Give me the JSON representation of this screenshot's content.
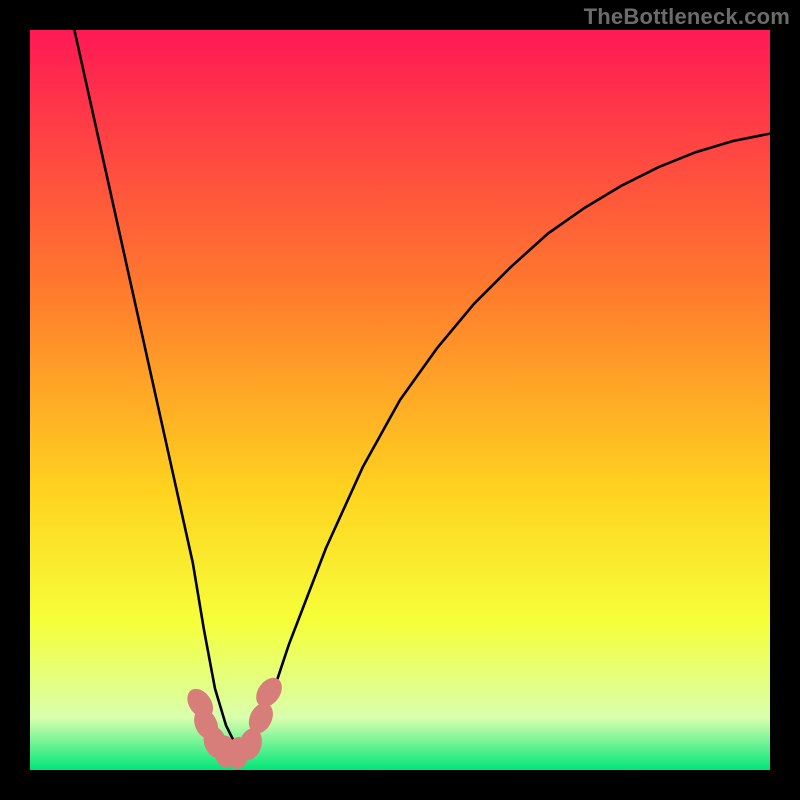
{
  "watermark": "TheBottleneck.com",
  "colors": {
    "background": "#000000",
    "gradient_top": "#ff1955",
    "gradient_mid1": "#ff7a2d",
    "gradient_mid2": "#ffd21f",
    "gradient_mid3": "#f6ff3a",
    "gradient_bottom_fade": "#d9ffad",
    "gradient_bottom": "#00e67a",
    "curve_stroke": "#000000",
    "marker_fill": "#d87e7a"
  },
  "chart_data": {
    "type": "line",
    "title": "",
    "xlabel": "",
    "ylabel": "",
    "xlim": [
      0,
      100
    ],
    "ylim": [
      0,
      100
    ],
    "grid": false,
    "curve": {
      "x": [
        6,
        8,
        10,
        12,
        14,
        16,
        18,
        20,
        22,
        23.5,
        25,
        26.5,
        28,
        29,
        30,
        32,
        35,
        40,
        45,
        50,
        55,
        60,
        65,
        70,
        75,
        80,
        85,
        90,
        95,
        100
      ],
      "y": [
        100,
        91,
        82,
        73,
        64,
        55,
        46,
        37,
        28,
        19,
        11,
        6,
        3,
        2,
        3,
        8,
        17,
        30,
        41,
        50,
        57,
        63,
        68,
        72.5,
        76,
        79,
        81.5,
        83.5,
        85,
        86
      ]
    },
    "markers": [
      {
        "x": 23.0,
        "y": 9.0
      },
      {
        "x": 23.8,
        "y": 6.2
      },
      {
        "x": 25.0,
        "y": 3.8
      },
      {
        "x": 26.4,
        "y": 2.5
      },
      {
        "x": 28.1,
        "y": 2.3
      },
      {
        "x": 29.8,
        "y": 3.5
      },
      {
        "x": 31.2,
        "y": 7.0
      },
      {
        "x": 32.3,
        "y": 10.5
      }
    ]
  }
}
